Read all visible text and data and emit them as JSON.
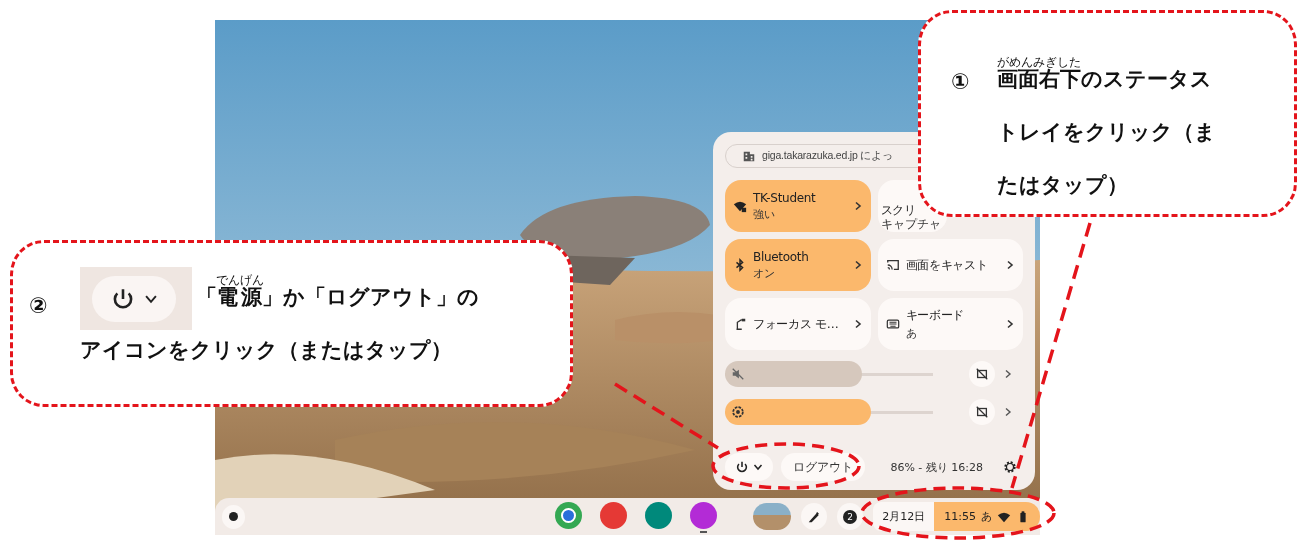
{
  "screen": {
    "kind": "picture",
    "quick_settings": {
      "managed_notice": "giga.takarazuka.ed.jp によっ",
      "tiles": [
        {
          "kind": "wifi",
          "title": "TK-Student",
          "subtitle": "強い",
          "on": true
        },
        {
          "kind": "capture",
          "title": "スクリ",
          "subtitle": "キャプチャ",
          "on": false
        },
        {
          "kind": "bluetooth",
          "title": "Bluetooth",
          "subtitle": "オン",
          "on": true
        },
        {
          "kind": "cast",
          "title": "画面をキャスト",
          "on": false
        },
        {
          "kind": "focus",
          "title": "フォーカス モ…",
          "on": false
        },
        {
          "kind": "keyboard",
          "title": "キーボード",
          "subtitle": "あ",
          "on": false
        }
      ],
      "sliders": [
        {
          "kind": "volume",
          "muted": true,
          "level": 0.66
        },
        {
          "kind": "brightness",
          "muted": false,
          "level": 0.7
        }
      ],
      "logout_label": "ログアウト",
      "battery": "86% - 残り 16:28"
    },
    "shelf": {
      "apps": [
        {
          "kind": "browser",
          "running": false
        },
        {
          "kind": "paint",
          "running": false
        },
        {
          "kind": "classroom",
          "running": false
        },
        {
          "kind": "canvas",
          "running": true
        }
      ],
      "notification_count": "2",
      "date": "2月12日",
      "time": "11:55",
      "ime": "あ"
    }
  },
  "callouts": [
    {
      "number": "①",
      "inset": false,
      "lines": [
        [
          {
            "text": "画面右下",
            "ruby": "がめんみぎした"
          },
          {
            "text": "のステータストレイをクリック（またはタップ）"
          }
        ]
      ]
    },
    {
      "number": "②",
      "inset": true,
      "lines": [
        [
          {
            "text": "「"
          },
          {
            "text": "電源",
            "ruby": "でんげん"
          },
          {
            "text": "」か「ログアウト」の"
          }
        ],
        [
          {
            "text": "アイコンをクリック（またはタップ）"
          }
        ]
      ]
    }
  ]
}
